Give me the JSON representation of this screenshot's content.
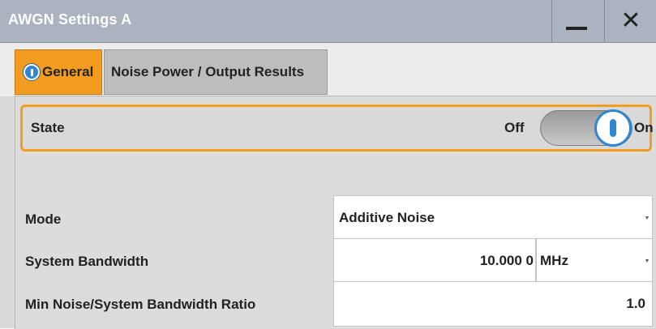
{
  "window": {
    "title": "AWGN Settings A",
    "minimize_icon": "minimize-icon",
    "close_icon": "close-icon",
    "close_glyph": "✕"
  },
  "tabs": [
    {
      "label": "General",
      "active": true,
      "icon": "info-icon"
    },
    {
      "label": "Noise Power / Output Results",
      "active": false
    }
  ],
  "state": {
    "label": "State",
    "off_label": "Off",
    "on_label": "On",
    "value": "On"
  },
  "mode": {
    "label": "Mode",
    "value": "Additive Noise"
  },
  "system_bandwidth": {
    "label": "System Bandwidth",
    "value": "10.000 0",
    "unit": "MHz"
  },
  "min_noise_ratio": {
    "label": "Min Noise/System Bandwidth Ratio",
    "value": "1.0"
  },
  "colors": {
    "active_tab": "#f39c1f",
    "title_bar": "#aab3bf",
    "accent_blue": "#2f87d1"
  }
}
